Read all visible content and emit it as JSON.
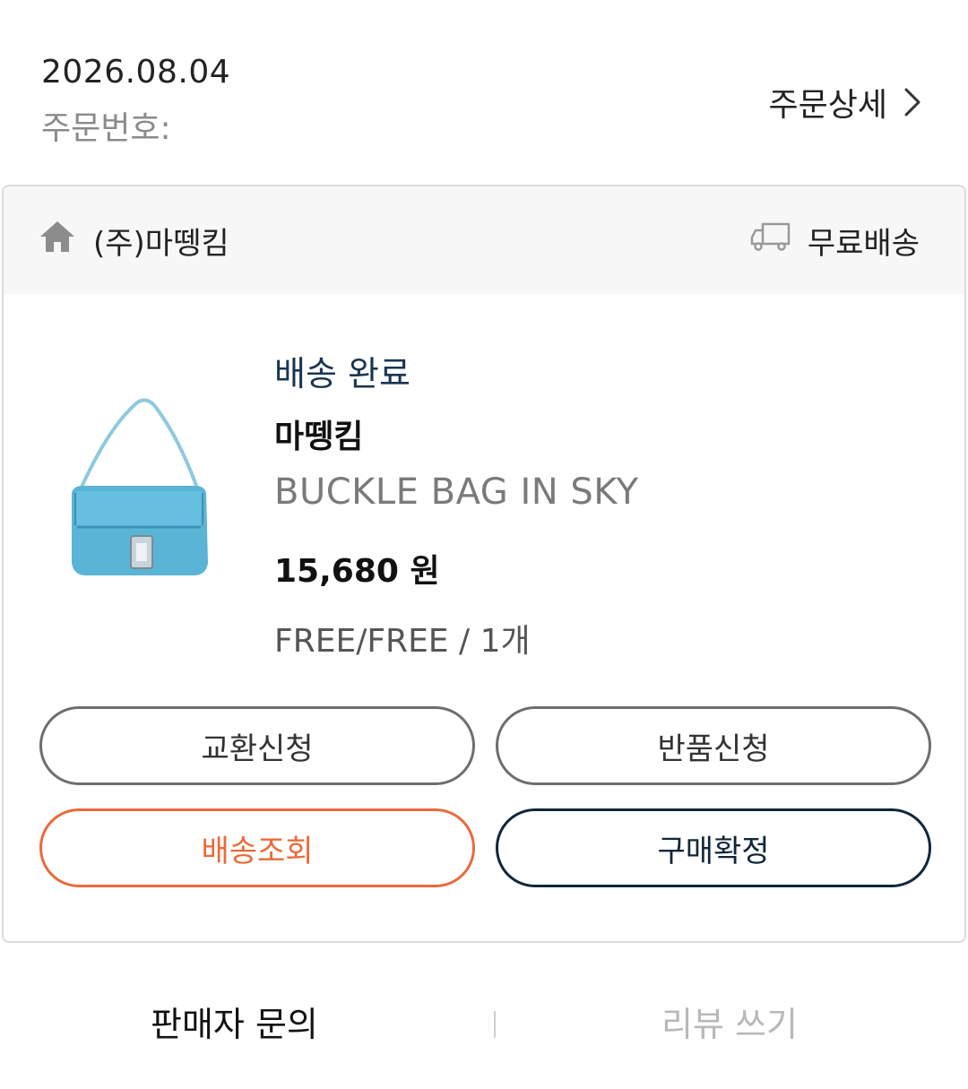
{
  "order": {
    "date": "2026.08.04",
    "number_label": "주문번호:",
    "detail_label": "주문상세"
  },
  "seller": {
    "name": "(주)마뗑킴",
    "shipping": "무료배송"
  },
  "product": {
    "status": "배송 완료",
    "brand": "마뗑킴",
    "name": "BUCKLE BAG IN SKY",
    "price": "15,680 원",
    "option": "FREE/FREE / 1개",
    "image_icon": "sky-blue-buckle-bag"
  },
  "buttons": {
    "exchange": "교환신청",
    "return": "반품신청",
    "tracking": "배송조회",
    "confirm": "구매확정"
  },
  "bottom": {
    "inquiry": "판매자 문의",
    "review": "리뷰 쓰기"
  },
  "colors": {
    "status": "#1b3550",
    "tracking": "#ea6a3a",
    "confirm": "#10263a",
    "bag": "#5ab4d6"
  }
}
